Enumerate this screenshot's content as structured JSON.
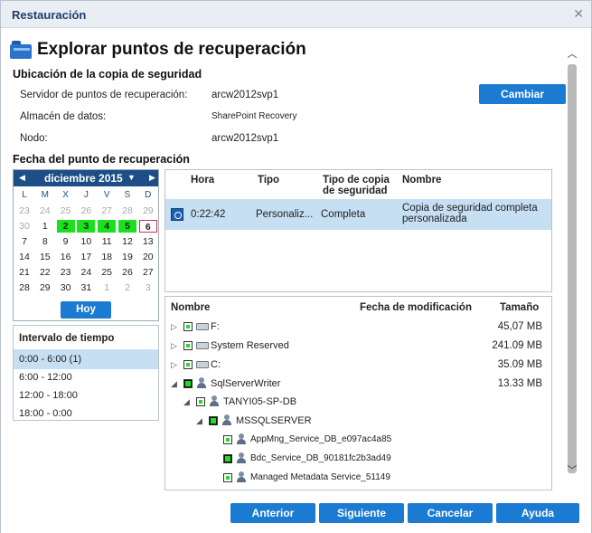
{
  "window": {
    "title": "Restauración"
  },
  "header": {
    "title": "Explorar puntos de recuperación"
  },
  "backup_location": {
    "section_title": "Ubicación de la copia de seguridad",
    "fields": [
      {
        "label": "Servidor de puntos de recuperación:",
        "value": "arcw2012svp1"
      },
      {
        "label": "Almacén de datos:",
        "value": "SharePoint Recovery"
      },
      {
        "label": "Nodo:",
        "value": "arcw2012svp1"
      }
    ],
    "change_button": "Cambiar"
  },
  "recovery_date": {
    "section_title": "Fecha del punto de recuperación",
    "calendar": {
      "prev": "◀",
      "month": "diciembre 2015",
      "dropdown": "▼",
      "next": "▶",
      "weekdays": [
        "L",
        "M",
        "X",
        "J",
        "V",
        "S",
        "D"
      ],
      "days": [
        [
          "23",
          "24",
          "25",
          "26",
          "27",
          "28",
          "29"
        ],
        [
          "30",
          "1",
          "2",
          "3",
          "4",
          "5",
          "6"
        ],
        [
          "7",
          "8",
          "9",
          "10",
          "11",
          "12",
          "13"
        ],
        [
          "14",
          "15",
          "16",
          "17",
          "18",
          "19",
          "20"
        ],
        [
          "21",
          "22",
          "23",
          "24",
          "25",
          "26",
          "27"
        ],
        [
          "28",
          "29",
          "30",
          "31",
          "1",
          "2",
          "3"
        ]
      ],
      "today_button": "Hoy"
    },
    "time_interval": {
      "title": "Intervalo de tiempo",
      "items": [
        "0:00 - 6:00   (1)",
        "6:00 - 12:00",
        "12:00 - 18:00",
        "18:00 - 0:00"
      ]
    }
  },
  "recovery_points": {
    "columns": [
      "Hora",
      "Tipo",
      "Tipo de copia de seguridad",
      "Nombre"
    ],
    "rows": [
      {
        "time": "0:22:42",
        "type": "Personaliz...",
        "backup_type": "Completa",
        "name": "Copia de seguridad completa personalizada"
      }
    ]
  },
  "file_tree": {
    "columns": [
      "Nombre",
      "Fecha de modificación",
      "Tamaño"
    ],
    "rows": [
      {
        "name": "F:",
        "size": "45,07 MB",
        "icon": "drive-icon"
      },
      {
        "name": "System Reserved",
        "size": "241.09 MB",
        "icon": "drive-icon"
      },
      {
        "name": "C:",
        "size": "35.09 MB",
        "icon": "drive-icon"
      },
      {
        "name": "SqlServerWriter",
        "size": "13.33 MB",
        "icon": "writer-icon"
      },
      {
        "name": "TANYI05-SP-DB",
        "size": "",
        "icon": "server-icon"
      },
      {
        "name": "MSSQLSERVER",
        "size": "",
        "icon": "instance-icon"
      },
      {
        "name": "AppMng_Service_DB_e097ac4a85",
        "size": "",
        "icon": "database-icon"
      },
      {
        "name": "Bdc_Service_DB_90181fc2b3ad49",
        "size": "",
        "icon": "database-icon"
      },
      {
        "name": "Managed Metadata Service_51149",
        "size": "",
        "icon": "database-icon"
      }
    ]
  },
  "footer": {
    "back": "Anterior",
    "next": "Siguiente",
    "cancel": "Cancelar",
    "help": "Ayuda"
  }
}
